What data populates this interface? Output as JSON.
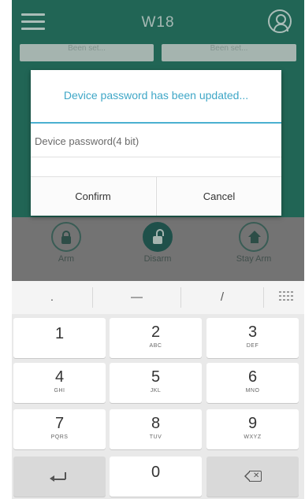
{
  "app": {
    "title": "W18",
    "chips": [
      "Been set...",
      "Been set..."
    ],
    "arm_buttons": [
      {
        "label": "Arm",
        "icon": "lock-closed-icon"
      },
      {
        "label": "Disarm",
        "icon": "lock-open-icon"
      },
      {
        "label": "Stay Arm",
        "icon": "home-lock-icon"
      }
    ]
  },
  "dialog": {
    "title": "Device password has been updated...",
    "input_placeholder": "Device password(4 bit)",
    "input_value": "",
    "confirm_label": "Confirm",
    "cancel_label": "Cancel"
  },
  "keyboard": {
    "symbols": [
      ".",
      "—",
      "/"
    ],
    "keys": [
      {
        "num": "1",
        "letters": ""
      },
      {
        "num": "2",
        "letters": "ABC"
      },
      {
        "num": "3",
        "letters": "DEF"
      },
      {
        "num": "4",
        "letters": "GHI"
      },
      {
        "num": "5",
        "letters": "JKL"
      },
      {
        "num": "6",
        "letters": "MNO"
      },
      {
        "num": "7",
        "letters": "PQRS"
      },
      {
        "num": "8",
        "letters": "TUV"
      },
      {
        "num": "9",
        "letters": "WXYZ"
      }
    ],
    "zero": "0"
  },
  "colors": {
    "app_bg": "#1f7a64",
    "accent": "#3fa7c7",
    "keyboard_bg": "#e9e9e9"
  }
}
